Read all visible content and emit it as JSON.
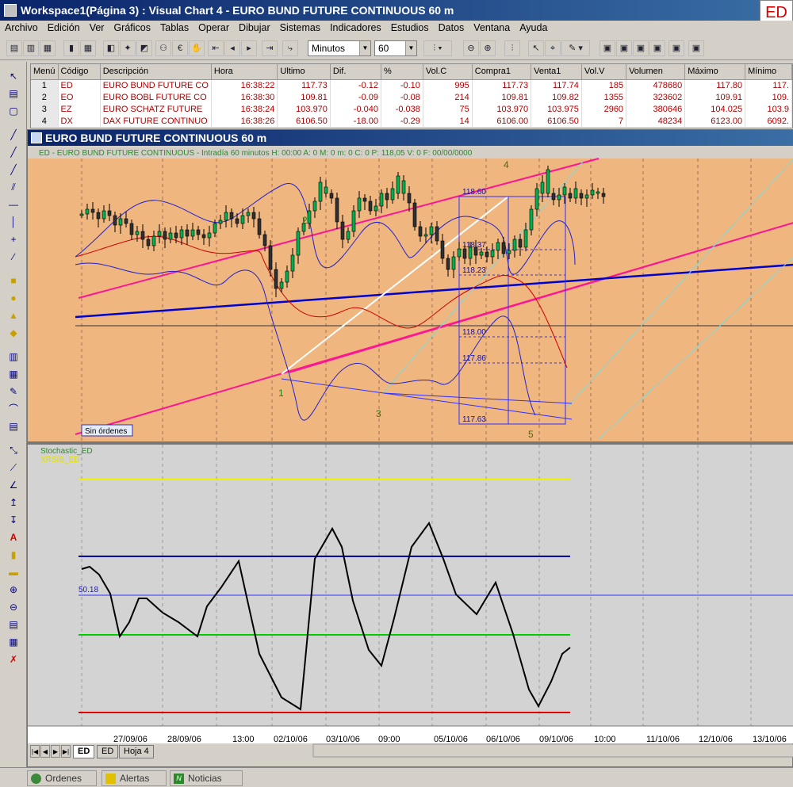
{
  "window": {
    "title": "Workspace1(Página 3) : Visual Chart 4 - EURO BUND FUTURE CONTINUOUS 60 m",
    "badge": "ED"
  },
  "menu": [
    "Archivo",
    "Edición",
    "Ver",
    "Gráficos",
    "Tablas",
    "Operar",
    "Dibujar",
    "Sistemas",
    "Indicadores",
    "Estudios",
    "Datos",
    "Ventana",
    "Ayuda"
  ],
  "toolbar": {
    "period_unit": "Minutos",
    "period_value": "60"
  },
  "quotes": {
    "columns": [
      "Menú",
      "Código",
      "Descripción",
      "Hora",
      "Ultimo",
      "Dif.",
      "%",
      "Vol.C",
      "Compra1",
      "Venta1",
      "Vol.V",
      "Volumen",
      "Máximo",
      "Mínimo"
    ],
    "rows": [
      [
        "1",
        "ED",
        "EURO BUND FUTURE CO",
        "16:38:22",
        "117.73",
        "-0.12",
        "-0.10",
        "995",
        "117.73",
        "117.74",
        "185",
        "478680",
        "117.80",
        "117."
      ],
      [
        "2",
        "EO",
        "EURO BOBL FUTURE CO",
        "16:38:30",
        "109.81",
        "-0.09",
        "-0.08",
        "214",
        "109.81",
        "109.82",
        "1355",
        "323602",
        "109.91",
        "109."
      ],
      [
        "3",
        "EZ",
        "EURO SCHATZ FUTURE",
        "16:38:24",
        "103.970",
        "-0.040",
        "-0.038",
        "75",
        "103.970",
        "103.975",
        "2960",
        "380646",
        "104.025",
        "103.9"
      ],
      [
        "4",
        "DX",
        "DAX FUTURE CONTINUO",
        "16:38:26",
        "6106.50",
        "-18.00",
        "-0.29",
        "14",
        "6106.00",
        "6106.50",
        "7",
        "48234",
        "6123.00",
        "6092."
      ]
    ]
  },
  "chart": {
    "caption": "EURO BUND FUTURE CONTINUOUS 60 m",
    "info_line": "ED - EURO BUND FUTURE CONTINUOUS - Intradía 60 minutos  H: 00:00  A: 0  M: 0  m: 0  C: 0  P: 118,05  V: 0  F: 00/00/0000",
    "fib_levels": [
      "118.60",
      "118.37",
      "118.23",
      "118.00",
      "117.86",
      "117.63"
    ],
    "wave_labels": [
      "1",
      "2",
      "3",
      "4",
      "5"
    ],
    "orders_label": "Sin órdenes",
    "stoch_title": "Stochastic_ED",
    "stoch_subtitle": "XRSIB_ED",
    "stoch_value": "50.18",
    "date_labels": [
      "27/09/06",
      "28/09/06",
      "13:00",
      "02/10/06",
      "03/10/06",
      "09:00",
      "05/10/06",
      "06/10/06",
      "09/10/06",
      "10:00",
      "11/10/06",
      "12/10/06",
      "13/10/06"
    ]
  },
  "sheets": [
    "ED",
    "ED",
    "Hoja 4"
  ],
  "statusbar": {
    "tabs": [
      "Ordenes",
      "Alertas",
      "Noticias"
    ]
  }
}
